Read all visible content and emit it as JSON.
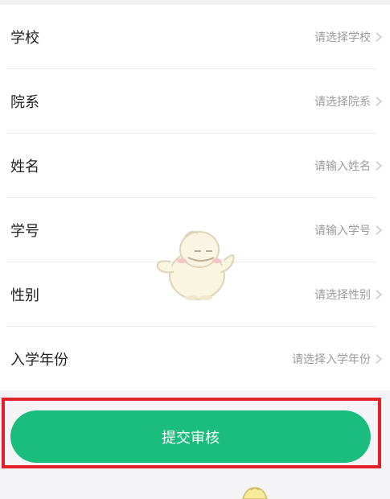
{
  "form": {
    "rows": [
      {
        "label": "学校",
        "value": "请选择学校"
      },
      {
        "label": "院系",
        "value": "请选择院系"
      },
      {
        "label": "姓名",
        "value": "请输入姓名"
      },
      {
        "label": "学号",
        "value": "请输入学号"
      },
      {
        "label": "性别",
        "value": "请选择性别"
      },
      {
        "label": "入学年份",
        "value": "请选择入学年份"
      }
    ]
  },
  "submit": {
    "label": "提交审核"
  },
  "colors": {
    "accent": "#1bbd7f",
    "highlight": "#e0202a",
    "placeholder": "#9b9b9b"
  },
  "icons": {
    "chevron": "chevron-right-icon",
    "mascot": "mascot-watermark"
  }
}
